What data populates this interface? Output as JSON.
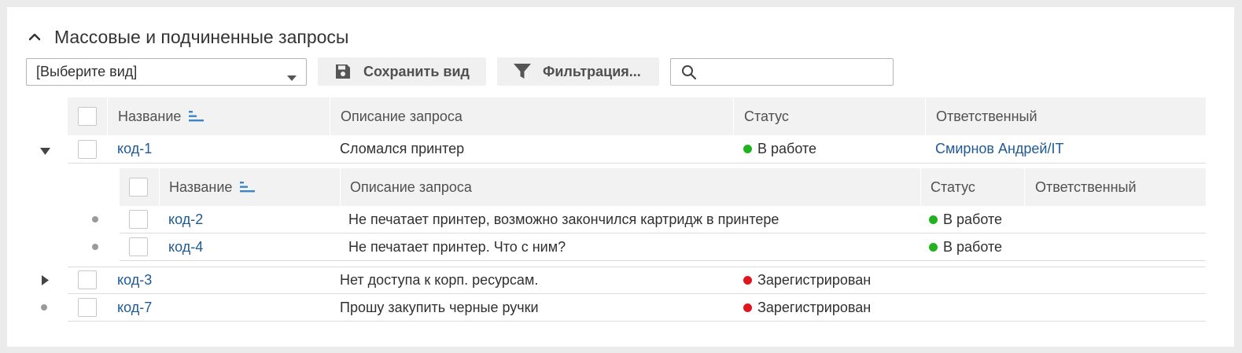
{
  "section": {
    "title": "Массовые и подчиненные запросы"
  },
  "toolbar": {
    "view_select_value": "[Выберите вид]",
    "save_view_label": "Сохранить вид",
    "filter_label": "Фильтрация...",
    "search_value": ""
  },
  "table": {
    "columns": [
      "Название",
      "Описание запроса",
      "Статус",
      "Ответственный"
    ],
    "rows": [
      {
        "name": "код-1",
        "description": "Сломался принтер",
        "status": "В работе",
        "assignee": "Смирнов Андрей/IT",
        "expanded": true
      },
      {
        "name": "код-3",
        "description": "Нет доступа к корп. ресурсам.",
        "status": "Зарегистрирован",
        "assignee": "",
        "expanded": false
      },
      {
        "name": "код-7",
        "description": "Прошу закупить черные ручки",
        "status": "Зарегистрирован",
        "assignee": ""
      }
    ]
  },
  "subtable": {
    "columns": [
      "Название",
      "Описание запроса",
      "Статус",
      "Ответственный"
    ],
    "rows": [
      {
        "name": "код-2",
        "description": "Не печатает принтер, возможно закончился картридж в принтере",
        "status": "В работе",
        "assignee": ""
      },
      {
        "name": "код-4",
        "description": "Не печатает принтер. Что с ним?",
        "status": "В работе",
        "assignee": ""
      }
    ]
  },
  "colors": {
    "status_in_work": "#22b11f",
    "status_registered": "#e0161e",
    "link": "#1f5a96",
    "sort_icon": "#3a86c8"
  },
  "icons": {
    "collapse": "chevron-up-icon",
    "save": "floppy-disk-icon",
    "filter": "funnel-icon",
    "search": "magnifier-icon",
    "sort": "sort-ascending-icon"
  }
}
